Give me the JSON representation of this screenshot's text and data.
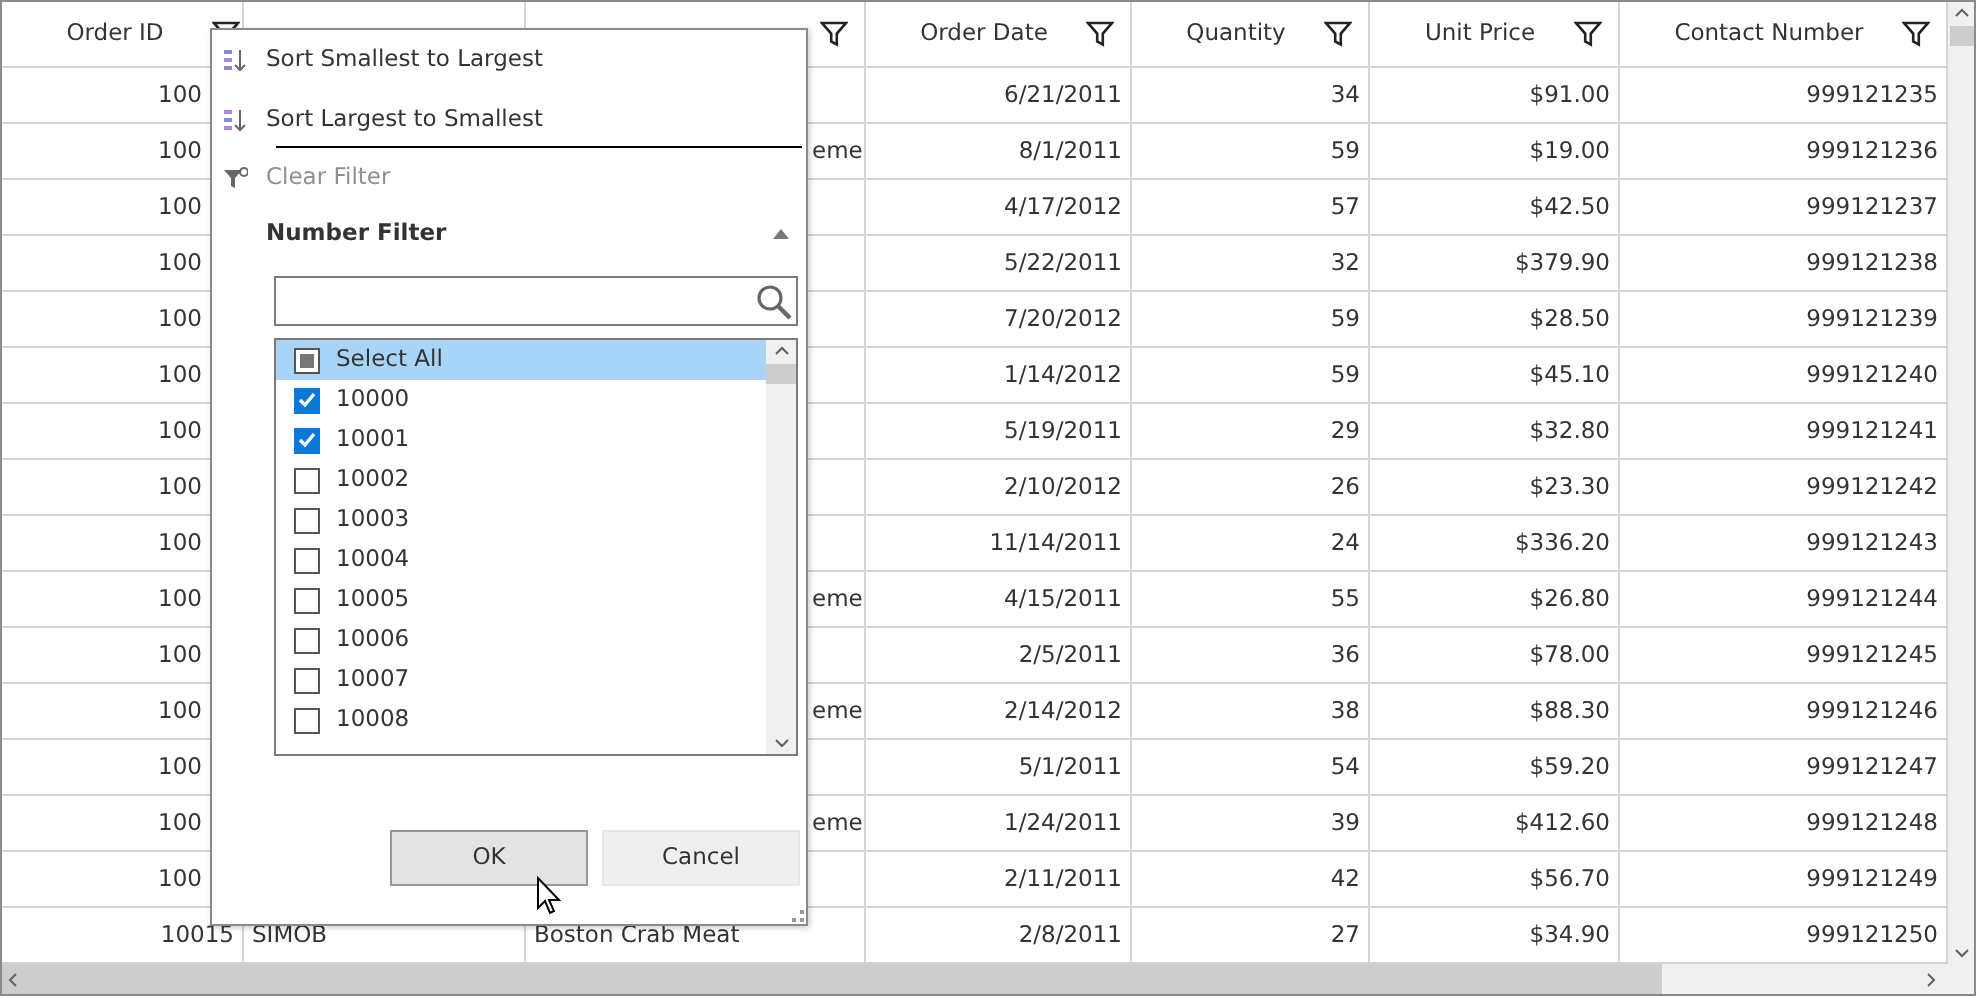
{
  "grid": {
    "columns": [
      {
        "label": "Order ID",
        "filter_button": true
      },
      {
        "filter_button": false
      },
      {
        "filter_button": true
      },
      {
        "label": "Order Date",
        "filter_button": true
      },
      {
        "label": "Quantity",
        "filter_button": true
      },
      {
        "label": "Unit Price",
        "filter_button": true
      },
      {
        "label": "Contact Number",
        "filter_button": true
      }
    ],
    "rows": [
      [
        "100",
        null,
        null,
        "6/21/2011",
        "34",
        "$91.00",
        "999121235"
      ],
      [
        "100",
        null,
        "eme",
        "8/1/2011",
        "59",
        "$19.00",
        "999121236"
      ],
      [
        "100",
        null,
        null,
        "4/17/2012",
        "57",
        "$42.50",
        "999121237"
      ],
      [
        "100",
        null,
        null,
        "5/22/2011",
        "32",
        "$379.90",
        "999121238"
      ],
      [
        "100",
        null,
        null,
        "7/20/2012",
        "59",
        "$28.50",
        "999121239"
      ],
      [
        "100",
        null,
        null,
        "1/14/2012",
        "59",
        "$45.10",
        "999121240"
      ],
      [
        "100",
        null,
        null,
        "5/19/2011",
        "29",
        "$32.80",
        "999121241"
      ],
      [
        "100",
        null,
        null,
        "2/10/2012",
        "26",
        "$23.30",
        "999121242"
      ],
      [
        "100",
        null,
        null,
        "11/14/2011",
        "24",
        "$336.20",
        "999121243"
      ],
      [
        "100",
        null,
        "eme",
        "4/15/2011",
        "55",
        "$26.80",
        "999121244"
      ],
      [
        "100",
        null,
        null,
        "2/5/2011",
        "36",
        "$78.00",
        "999121245"
      ],
      [
        "100",
        null,
        "eme",
        "2/14/2012",
        "38",
        "$88.30",
        "999121246"
      ],
      [
        "100",
        null,
        null,
        "5/1/2011",
        "54",
        "$59.20",
        "999121247"
      ],
      [
        "100",
        null,
        "eme",
        "1/24/2011",
        "39",
        "$412.60",
        "999121248"
      ],
      [
        "100",
        null,
        null,
        "2/11/2011",
        "42",
        "$56.70",
        "999121249"
      ],
      [
        "10015",
        "SIMOB",
        "Boston Crab Meat",
        "2/8/2011",
        "27",
        "$34.90",
        "999121250"
      ]
    ]
  },
  "filter_popup": {
    "menu": [
      {
        "kind": "sort-ascending",
        "label": "Sort Smallest to Largest",
        "disabled": false
      },
      {
        "kind": "sort-descending",
        "label": "Sort Largest to Smallest",
        "disabled": false
      },
      {
        "kind": "clear-filter",
        "label": "Clear Filter",
        "disabled": true
      }
    ],
    "section": {
      "title": "Number Filter",
      "expanded": true
    },
    "items": [
      {
        "label": "Select All",
        "checked": false,
        "indeterminate": true,
        "selected": true
      },
      {
        "label": "10000",
        "checked": true,
        "selected": false
      },
      {
        "label": "10001",
        "checked": true,
        "selected": false
      },
      {
        "label": "10002",
        "checked": false,
        "selected": false
      },
      {
        "label": "10003",
        "checked": false,
        "selected": false
      },
      {
        "label": "10004",
        "checked": false,
        "selected": false
      },
      {
        "label": "10005",
        "checked": false,
        "selected": false
      },
      {
        "label": "10006",
        "checked": false,
        "selected": false
      },
      {
        "label": "10007",
        "checked": false,
        "selected": false
      },
      {
        "label": "10008",
        "checked": false,
        "selected": false
      }
    ],
    "buttons": [
      {
        "label": "OK",
        "hovered": true
      },
      {
        "label": "Cancel",
        "hovered": false
      }
    ]
  }
}
